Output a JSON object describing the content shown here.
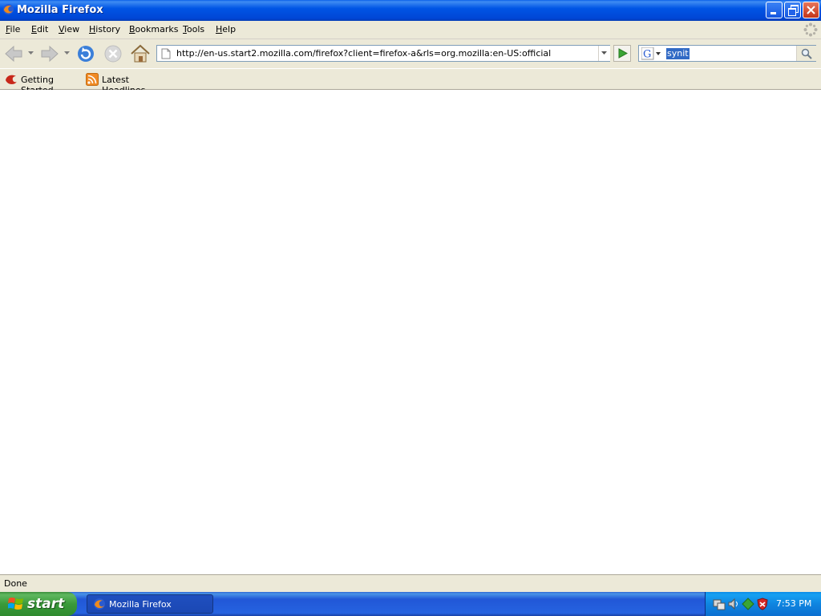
{
  "window": {
    "title": "Mozilla Firefox"
  },
  "menu": [
    "File",
    "Edit",
    "View",
    "History",
    "Bookmarks",
    "Tools",
    "Help"
  ],
  "nav": {
    "url": "http://en-us.start2.mozilla.com/firefox?client=firefox-a&rls=org.mozilla:en-US:official",
    "search_value": "synit",
    "search_engine_icon": "google-G-icon"
  },
  "bookmarks": [
    {
      "label": "Getting Started",
      "icon": "firefox-bookmark-icon"
    },
    {
      "label": "Latest Headlines",
      "icon": "rss-feed-icon"
    }
  ],
  "status": {
    "text": "Done"
  },
  "taskbar": {
    "start_label": "start",
    "task_label": "Mozilla Firefox",
    "clock": "7:53 PM"
  },
  "colors": {
    "titlebar": "#0055e5",
    "chrome": "#ece9d8",
    "taskbar": "#2663e0",
    "start": "#3a9a3a",
    "selection": "#316ac5"
  }
}
